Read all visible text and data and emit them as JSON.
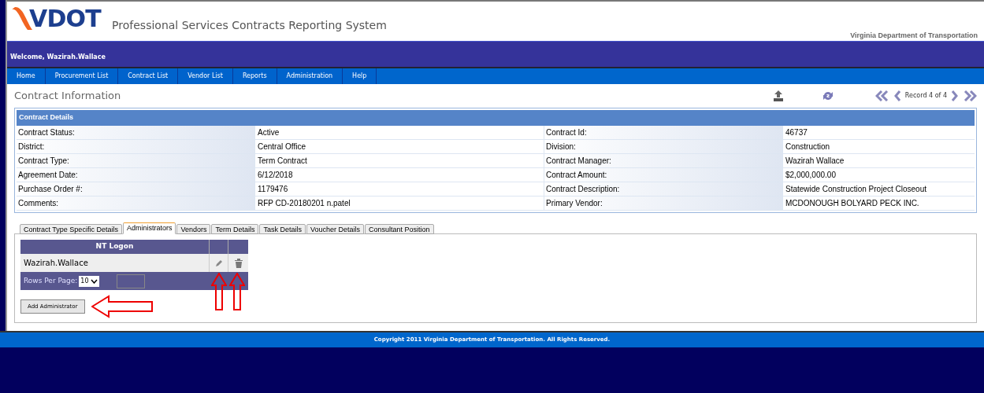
{
  "header": {
    "logo": "VDOT",
    "title": "Professional Services Contracts Reporting System",
    "agency": "Virginia Department of Transportation"
  },
  "welcome": "Welcome, Wazirah.Wallace",
  "nav": [
    "Home",
    "Procurement List",
    "Contract List",
    "Vendor List",
    "Reports",
    "Administration",
    "Help"
  ],
  "page_title": "Contract Information",
  "pager": {
    "record": "Record 4 of 4"
  },
  "details": {
    "title": "Contract Details",
    "rows": [
      {
        "label": "Contract Status:",
        "value": "Active",
        "label_2": "Contract Id:",
        "value_2": "46737"
      },
      {
        "label": "District:",
        "value": "Central Office",
        "label_2": "Division:",
        "value_2": "Construction"
      },
      {
        "label": "Contract Type:",
        "value": "Term Contract",
        "label_2": "Contract Manager:",
        "value_2": "Wazirah Wallace"
      },
      {
        "label": "Agreement Date:",
        "value": "6/12/2018",
        "label_2": "Contract Amount:",
        "value_2": "$2,000,000.00"
      },
      {
        "label": "Purchase Order #:",
        "value": "1179476",
        "label_2": "Contract Description:",
        "value_2": "Statewide Construction Project Closeout"
      },
      {
        "label": "Comments:",
        "value": "RFP CD-20180201 n.patel",
        "label_2": "Primary Vendor:",
        "value_2": "MCDONOUGH BOLYARD PECK INC."
      }
    ]
  },
  "tabs": [
    {
      "label": "Contract Type Specific Details",
      "selected": false
    },
    {
      "label": "Administrators",
      "selected": true
    },
    {
      "label": "Vendors",
      "selected": false
    },
    {
      "label": "Term Details",
      "selected": false
    },
    {
      "label": "Task Details",
      "selected": false
    },
    {
      "label": "Voucher Details",
      "selected": false
    },
    {
      "label": "Consultant Position",
      "selected": false
    }
  ],
  "admins": {
    "column": "NT Logon",
    "rows": [
      "Wazirah.Wallace"
    ],
    "rows_per_page_label": "Rows Per Page:",
    "rows_per_page": "10"
  },
  "add_button": "Add Administrator",
  "footer": "Copyright 2011 Virginia Department of Transportation. All Rights Reserved."
}
